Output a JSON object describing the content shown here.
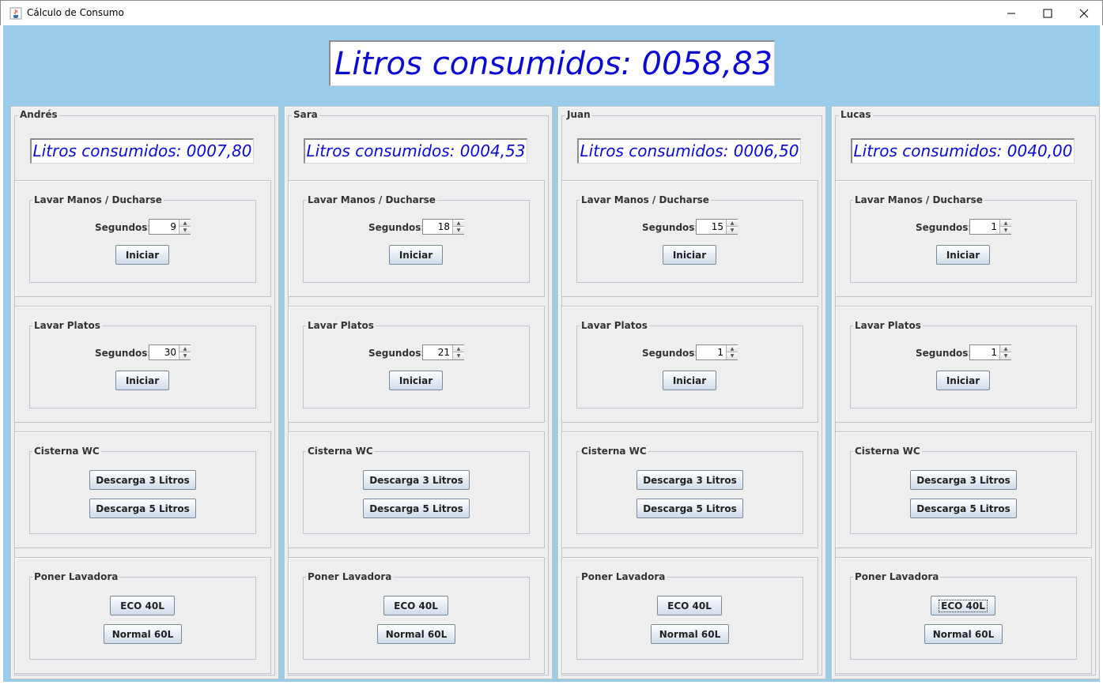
{
  "window": {
    "title": "Cálculo de Consumo",
    "icon": "java-cup-icon",
    "minimize_glyph": "–",
    "maximize_glyph": "☐",
    "close_glyph": "✕"
  },
  "total": {
    "text": "Litros consumidos: 0058,83",
    "color": "#0a0ad2"
  },
  "colors": {
    "background": "#98cce8",
    "panel": "#eeeeee",
    "liters_text": "#0a0ad2"
  },
  "labels": {
    "lavar_manos": "Lavar Manos / Ducharse",
    "lavar_platos": "Lavar Platos",
    "cisterna": "Cisterna WC",
    "lavadora": "Poner Lavadora",
    "segundos": "Segundos:",
    "iniciar": "Iniciar",
    "descarga3": "Descarga 3 Litros",
    "descarga5": "Descarga 5 Litros",
    "eco": "ECO 40L",
    "normal": "Normal 60L"
  },
  "persons": [
    {
      "name": "Andrés",
      "liters": "Litros consumidos: 0007,80",
      "manos_seconds": "9",
      "platos_seconds": "30"
    },
    {
      "name": "Sara",
      "liters": "Litros consumidos: 0004,53",
      "manos_seconds": "18",
      "platos_seconds": "21"
    },
    {
      "name": "Juan",
      "liters": "Litros consumidos: 0006,50",
      "manos_seconds": "15",
      "platos_seconds": "1"
    },
    {
      "name": "Lucas",
      "liters": "Litros consumidos: 0040,00",
      "manos_seconds": "1",
      "platos_seconds": "1"
    }
  ]
}
